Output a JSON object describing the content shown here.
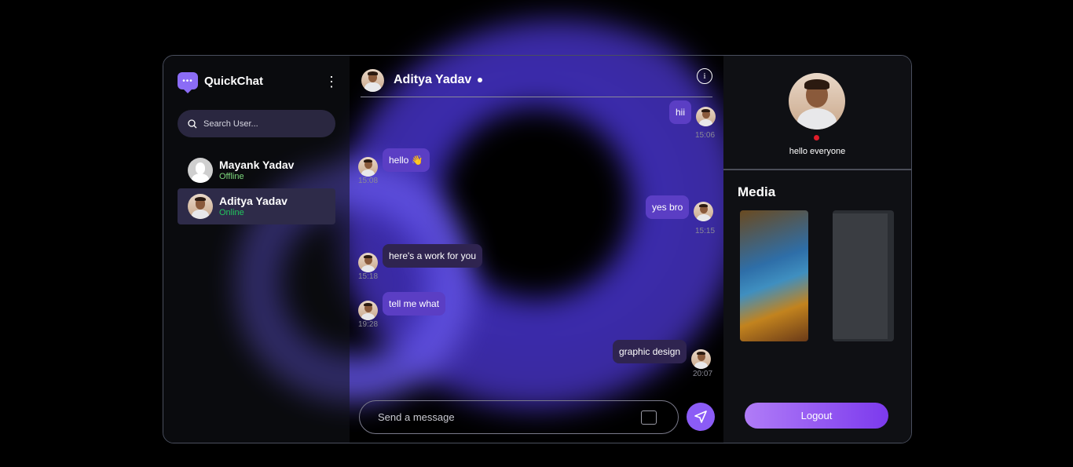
{
  "app": {
    "title": "QuickChat",
    "logo_glyph": "•••",
    "menu_glyph": "⋮"
  },
  "sidebar": {
    "search_placeholder": "Search User...",
    "users": [
      {
        "name": "Mayank Yadav",
        "status": "Offline"
      },
      {
        "name": "Aditya Yadav",
        "status": "Online"
      }
    ]
  },
  "chat": {
    "contact_name": "Aditya Yadav",
    "info_glyph": "i",
    "messages": [
      {
        "text": "hii",
        "time": "15:06",
        "side": "right"
      },
      {
        "text": "hello  👋",
        "time": "15:08",
        "side": "left"
      },
      {
        "text": "yes bro",
        "time": "15:15",
        "side": "right"
      },
      {
        "text": "here's a work for you",
        "time": "15:18",
        "side": "left"
      },
      {
        "text": "tell me what",
        "time": "19:28",
        "side": "left"
      },
      {
        "text": "graphic design",
        "time": "20:07",
        "side": "right"
      }
    ],
    "input_placeholder": "Send a message"
  },
  "profile": {
    "bio": "hello everyone",
    "media_title": "Media",
    "logout_label": "Logout"
  },
  "colors": {
    "accent": "#8b5cf6",
    "online": "#22c55e",
    "offline_dot": "#e11d2a"
  }
}
